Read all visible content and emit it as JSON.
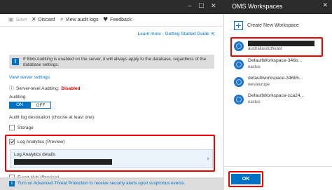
{
  "toolbar": {
    "save_label": "Save",
    "discard_label": "Discard",
    "audit_logs_label": "View audit logs",
    "feedback_label": "Feedback"
  },
  "learn_more": "Learn more - Getting Started Guide",
  "info_banner": "If Blob Auditing is enabled on the server, it will always apply to the database, regardless of the database settings.",
  "view_server_settings": "View server settings",
  "server_auditing": {
    "label": "Server-level Auditing:",
    "value": "Disabled"
  },
  "auditing": {
    "label": "Auditing",
    "on": "ON",
    "off": "OFF"
  },
  "destination_label": "Audit log destination (choose at least one):",
  "destinations": {
    "storage": "Storage",
    "log_analytics": "Log Analytics (Preview)",
    "event_hub": "Event Hub (Preview)"
  },
  "log_analytics_details": {
    "label": "Log Analytics details",
    "value": ""
  },
  "atp_link": "Turn on Advanced Threat Protection to receive security alerts upon suspicious events.",
  "oms": {
    "title": "OMS Workspaces",
    "create_label": "Create New Workspace",
    "workspaces": [
      {
        "name": "",
        "location": "australiasoutheast"
      },
      {
        "name": "DefaultWorkspace-346b...",
        "location": "eastus"
      },
      {
        "name": "defaultworkspace-346b5...",
        "location": "westeurope"
      },
      {
        "name": "DefaultWorkspace-cca24...",
        "location": "eastus"
      }
    ],
    "ok_label": "OK"
  },
  "colors": {
    "accent": "#0072c6",
    "highlight": "#e00000",
    "disabled": "#cc0000",
    "header": "#2b2b2b"
  },
  "icons": {
    "save": "save-icon",
    "discard": "close-icon",
    "audit_logs": "search-icon",
    "feedback": "heart-icon",
    "info": "info-icon",
    "workspace": "oms-workspace-icon",
    "create": "plus-icon"
  }
}
